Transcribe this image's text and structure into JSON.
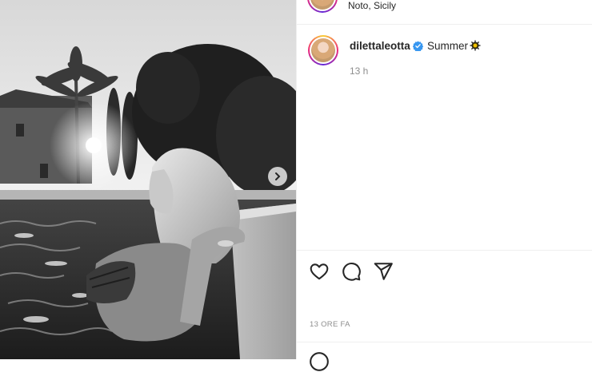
{
  "post": {
    "location": "Noto, Sicily",
    "username": "dilettaleotta",
    "caption": "Summer",
    "caption_emoji_icon": "sun-emoji-icon",
    "time_ago": "13 h",
    "date_label": "13 ORE FA",
    "verified": true
  },
  "actions": {
    "like_icon": "heart-icon",
    "comment_icon": "comment-icon",
    "share_icon": "share-icon"
  },
  "media": {
    "next_icon": "chevron-right-icon",
    "style": "black-and-white photo"
  },
  "colors": {
    "verified_blue": "#3897f0",
    "text_primary": "#262626",
    "text_secondary": "#8e8e8e",
    "divider": "#efefef"
  }
}
